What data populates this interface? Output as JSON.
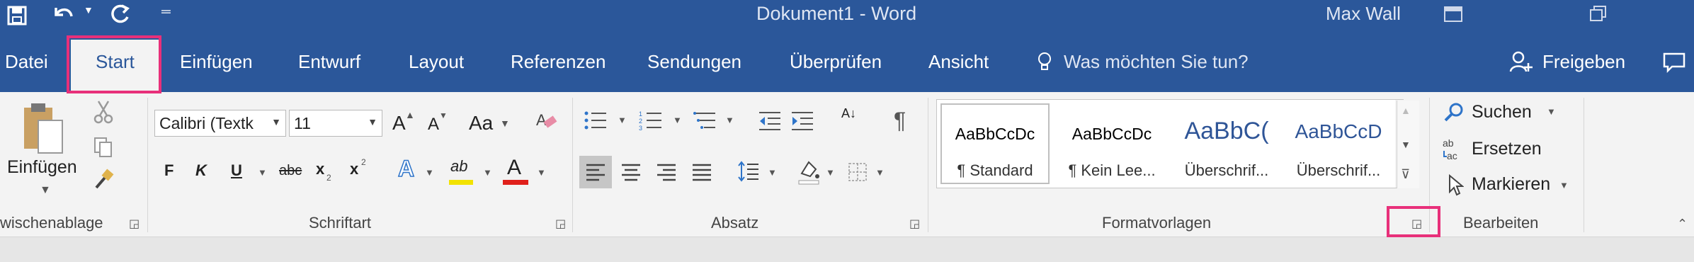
{
  "titlebar": {
    "doc_title": "Dokument1 - Word",
    "user": "Max Wall",
    "icons": [
      "save-icon",
      "undo-icon",
      "redo-icon",
      "customize-qat-icon",
      "ribbon-display-icon",
      "restore-icon"
    ]
  },
  "tabs": [
    "Datei",
    "Start",
    "Einfügen",
    "Entwurf",
    "Layout",
    "Referenzen",
    "Sendungen",
    "Überprüfen",
    "Ansicht"
  ],
  "tell_me": "Was möchten Sie tun?",
  "share": "Freigeben",
  "clipboard": {
    "paste_label": "Einfügen",
    "group_label": "wischenablage"
  },
  "font": {
    "font_name": "Calibri (Textk",
    "font_size": "11",
    "grow": "A",
    "shrink": "A",
    "case": "Aa",
    "bold": "F",
    "italic": "K",
    "underline": "U",
    "strike": "abc",
    "sub": "x",
    "sup": "x",
    "effects": "A",
    "highlight": "ab",
    "color": "A",
    "group_label": "Schriftart"
  },
  "paragraph": {
    "pilcrow": "¶",
    "sort": "A↓",
    "group_label": "Absatz"
  },
  "styles": {
    "items": [
      {
        "sample": "AaBbCcDc",
        "label": "¶ Standard"
      },
      {
        "sample": "AaBbCcDc",
        "label": "¶ Kein Lee..."
      },
      {
        "sample": "AaBbC(",
        "label": "Überschrif..."
      },
      {
        "sample": "AaBbCcD",
        "label": "Überschrif..."
      }
    ],
    "group_label": "Formatvorlagen"
  },
  "editing": {
    "find": "Suchen",
    "replace": "Ersetzen",
    "select": "Markieren",
    "group_label": "Bearbeiten"
  },
  "colors": {
    "brand": "#2b579a",
    "highlight_box": "#e8307a",
    "heading_blue": "#2f5597"
  }
}
